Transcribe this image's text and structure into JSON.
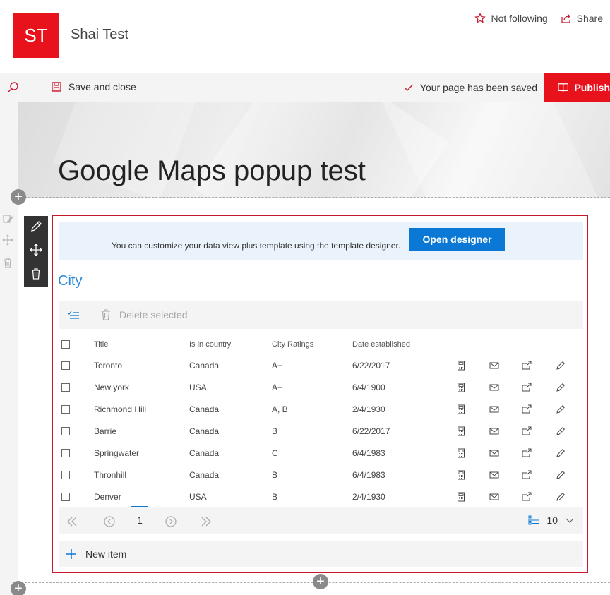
{
  "site": {
    "logo_text": "ST",
    "title": "Shai Test",
    "follow_label": "Not following",
    "share_label": "Share"
  },
  "commandbar": {
    "save_label": "Save and close",
    "saved_status": "Your page has been saved",
    "publish_label": "Publish"
  },
  "page": {
    "title": "Google Maps popup test"
  },
  "designer": {
    "text": "You can customize your data view plus template using the template designer.",
    "button_label": "Open designer"
  },
  "list": {
    "title": "City",
    "delete_label": "Delete selected",
    "columns": [
      "Title",
      "Is in country",
      "City Ratings",
      "Date established"
    ],
    "rows": [
      {
        "title": "Toronto",
        "country": "Canada",
        "rating": "A+",
        "date": "6/22/2017"
      },
      {
        "title": "New york",
        "country": "USA",
        "rating": "A+",
        "date": "6/4/1900"
      },
      {
        "title": "Richmond Hill",
        "country": "Canada",
        "rating": "A, B",
        "date": "2/4/1930"
      },
      {
        "title": "Barrie",
        "country": "Canada",
        "rating": "B",
        "date": "6/22/2017"
      },
      {
        "title": "Springwater",
        "country": "Canada",
        "rating": "C",
        "date": "6/4/1983"
      },
      {
        "title": "Thronhill",
        "country": "Canada",
        "rating": "B",
        "date": "6/4/1983"
      },
      {
        "title": "Denver",
        "country": "USA",
        "rating": "B",
        "date": "2/4/1930"
      }
    ],
    "pager": {
      "current_page": "1",
      "page_size": "10"
    },
    "new_item_label": "New item"
  },
  "colors": {
    "brand_red": "#e8121c",
    "accent_blue": "#0a78d4",
    "title_blue": "#2b88d8",
    "border_red": "#c7172b"
  },
  "icons": [
    "star-icon",
    "share-icon",
    "search-icon",
    "save-icon",
    "checkmark-icon",
    "book-icon",
    "edit-icon",
    "move-icon",
    "delete-icon",
    "calculator-icon",
    "mail-icon",
    "open-icon",
    "pencil-icon",
    "chevron-double-left-icon",
    "chevron-left-circle-icon",
    "chevron-right-circle-icon",
    "chevron-double-right-icon",
    "list-icon",
    "chevron-down-icon",
    "plus-icon"
  ]
}
